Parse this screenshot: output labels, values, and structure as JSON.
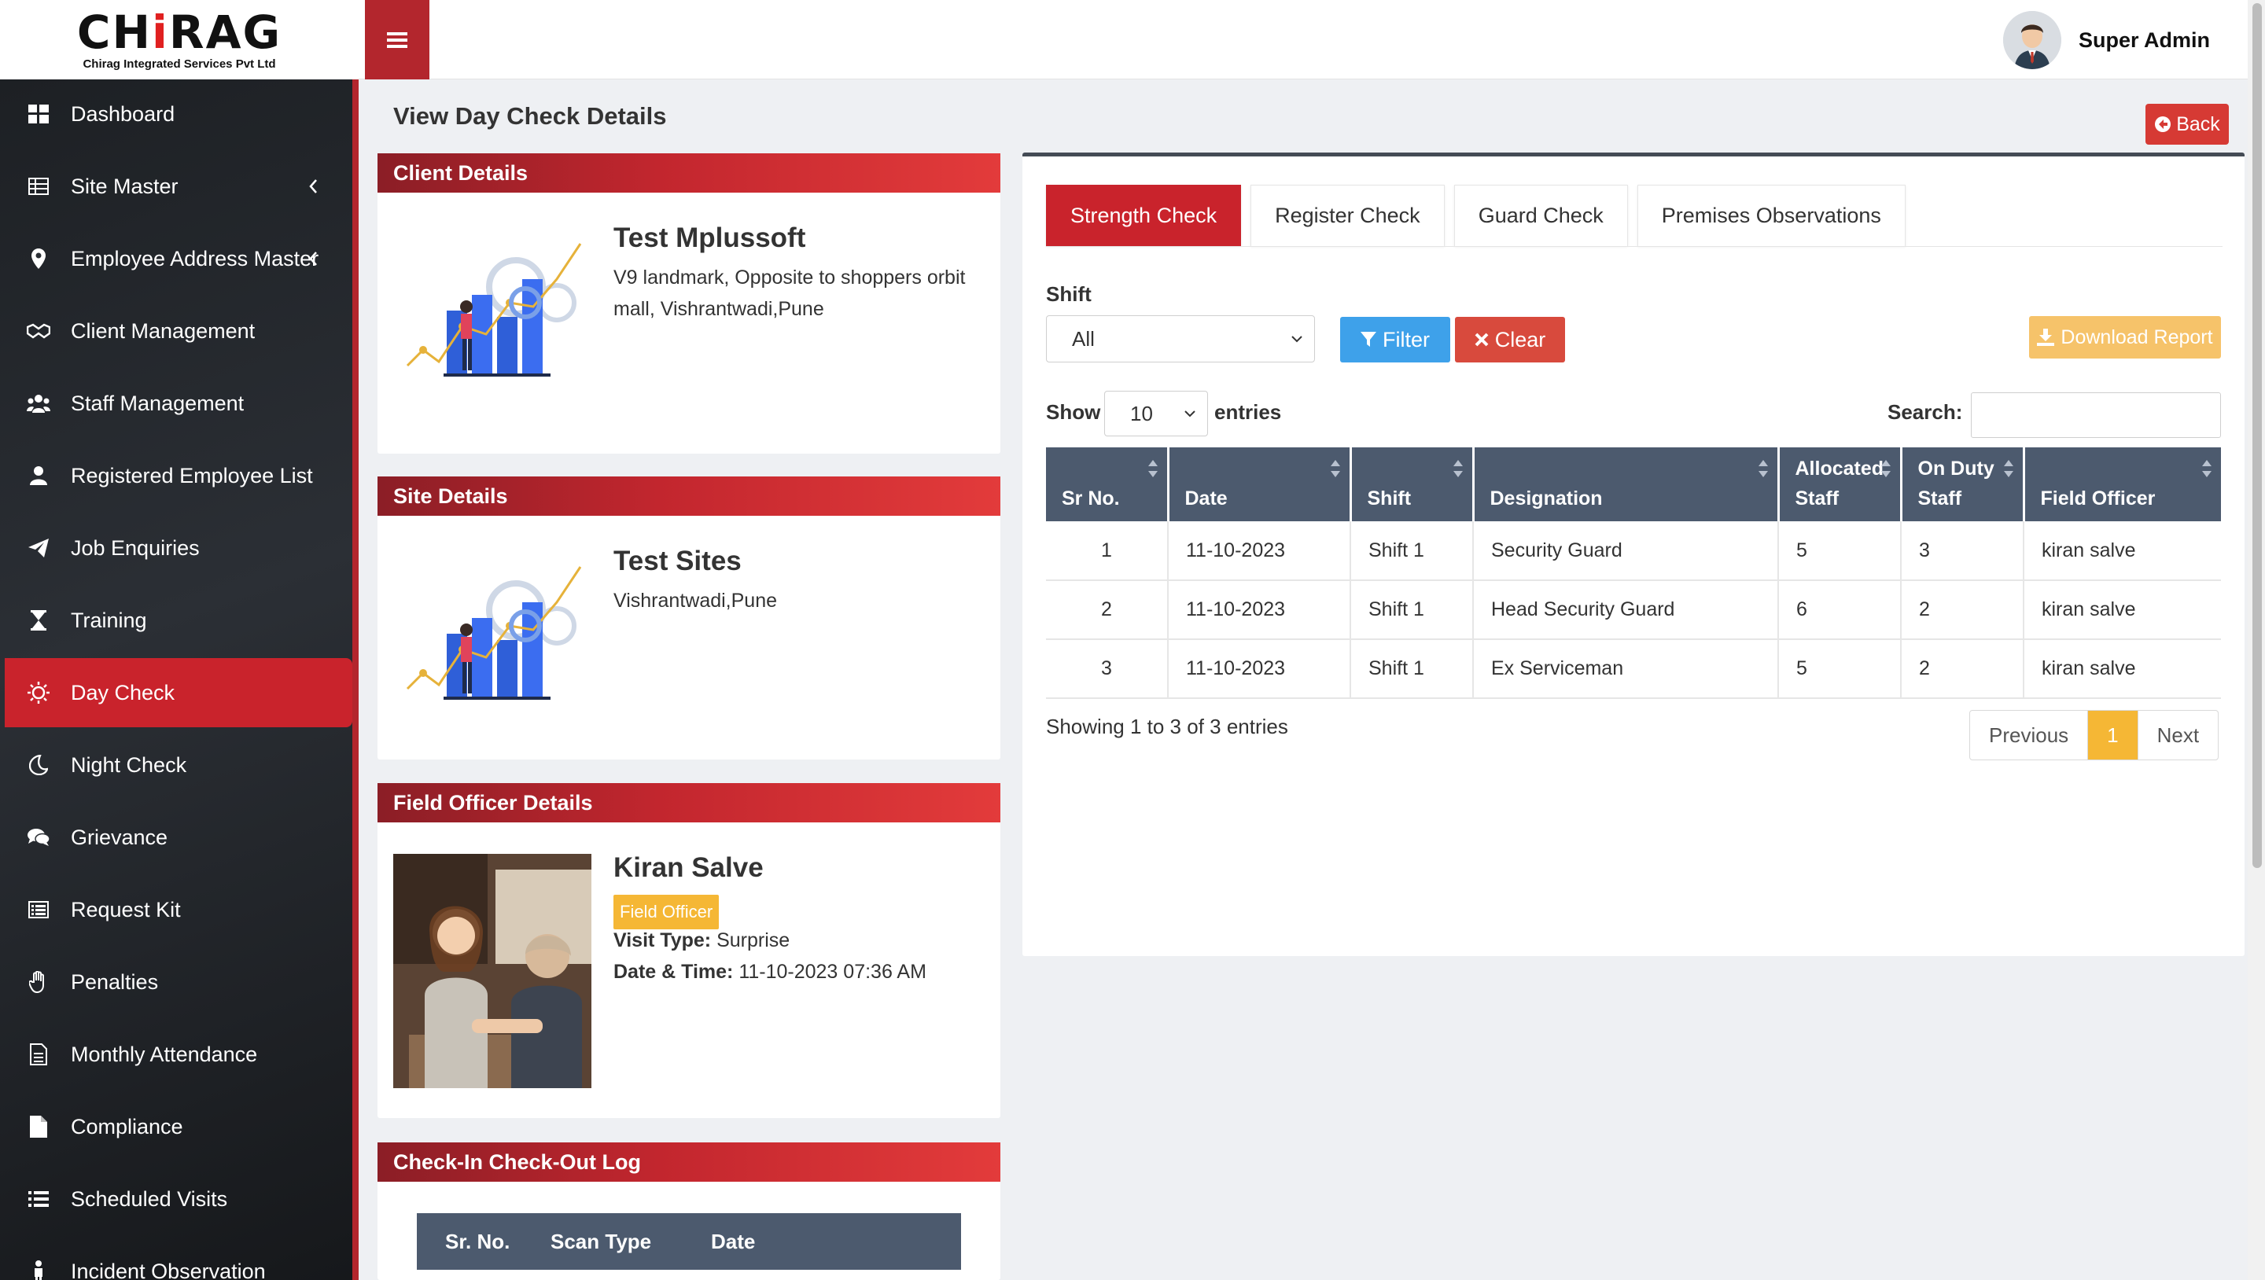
{
  "brand": {
    "logo_prefix": "CH",
    "logo_i": "i",
    "logo_suffix": "RAG",
    "company": "Chirag Integrated Services Pvt Ltd"
  },
  "header": {
    "user_name": "Super Admin"
  },
  "sidebar": {
    "items": [
      {
        "label": "Dashboard",
        "icon": "dashboard-icon"
      },
      {
        "label": "Site Master",
        "icon": "table-icon"
      },
      {
        "label": "Employee Address Master",
        "icon": "map-pin-icon"
      },
      {
        "label": "Client Management",
        "icon": "handshake-icon"
      },
      {
        "label": "Staff Management",
        "icon": "users-icon"
      },
      {
        "label": "Registered Employee List",
        "icon": "user-icon"
      },
      {
        "label": "Job Enquiries",
        "icon": "paper-plane-icon"
      },
      {
        "label": "Training",
        "icon": "hourglass-icon"
      },
      {
        "label": "Day Check",
        "icon": "sun-icon"
      },
      {
        "label": "Night Check",
        "icon": "moon-icon"
      },
      {
        "label": "Grievance",
        "icon": "comments-icon"
      },
      {
        "label": "Request Kit",
        "icon": "list-alt-icon"
      },
      {
        "label": "Penalties",
        "icon": "hand-icon"
      },
      {
        "label": "Monthly Attendance",
        "icon": "file-text-icon"
      },
      {
        "label": "Compliance",
        "icon": "file-icon"
      },
      {
        "label": "Scheduled Visits",
        "icon": "list-icon"
      },
      {
        "label": "Incident Observation",
        "icon": "person-icon"
      }
    ],
    "active": "Day Check"
  },
  "page": {
    "title": "View Day Check Details",
    "back_label": "Back"
  },
  "client": {
    "heading": "Client Details",
    "name": "Test Mplussoft",
    "address": "V9 landmark, Opposite to shoppers orbit mall, Vishrantwadi,Pune"
  },
  "site": {
    "heading": "Site Details",
    "name": "Test Sites",
    "address": "Vishrantwadi,Pune"
  },
  "field_officer": {
    "heading": "Field Officer Details",
    "name": "Kiran Salve",
    "role": "Field Officer",
    "visit_type_label": "Visit Type:",
    "visit_type": "Surprise",
    "datetime_label": "Date & Time:",
    "datetime": "11-10-2023 07:36 AM"
  },
  "log": {
    "heading": "Check-In Check-Out Log",
    "columns": [
      "Sr. No.",
      "Scan Type",
      "Date"
    ]
  },
  "tabs": [
    "Strength Check",
    "Register Check",
    "Guard Check",
    "Premises Observations"
  ],
  "active_tab": "Strength Check",
  "filters": {
    "shift_label": "Shift",
    "shift_value": "All",
    "filter_label": "Filter",
    "clear_label": "Clear",
    "download_label": "Download Report"
  },
  "table_controls": {
    "show_label": "Show",
    "entries_value": "10",
    "entries_label": "entries",
    "search_label": "Search:"
  },
  "table": {
    "columns": [
      "Sr No.",
      "Date",
      "Shift",
      "Designation",
      "Allocated Staff",
      "On Duty Staff",
      "Field Officer"
    ],
    "rows": [
      [
        "1",
        "11-10-2023",
        "Shift 1",
        "Security Guard",
        "5",
        "3",
        "kiran salve"
      ],
      [
        "2",
        "11-10-2023",
        "Shift 1",
        "Head Security Guard",
        "6",
        "2",
        "kiran salve"
      ],
      [
        "3",
        "11-10-2023",
        "Shift 1",
        "Ex Serviceman",
        "5",
        "2",
        "kiran salve"
      ]
    ]
  },
  "pagination": {
    "info": "Showing 1 to 3 of 3 entries",
    "previous": "Previous",
    "current": "1",
    "next": "Next"
  },
  "colors": {
    "brand_red": "#c9232c",
    "header_dark": "#4c5a6e",
    "filter_blue": "#3ea1ea",
    "clear_red": "#d84a3d",
    "download_orange": "#f6c36a",
    "badge_yellow": "#f5b735"
  }
}
